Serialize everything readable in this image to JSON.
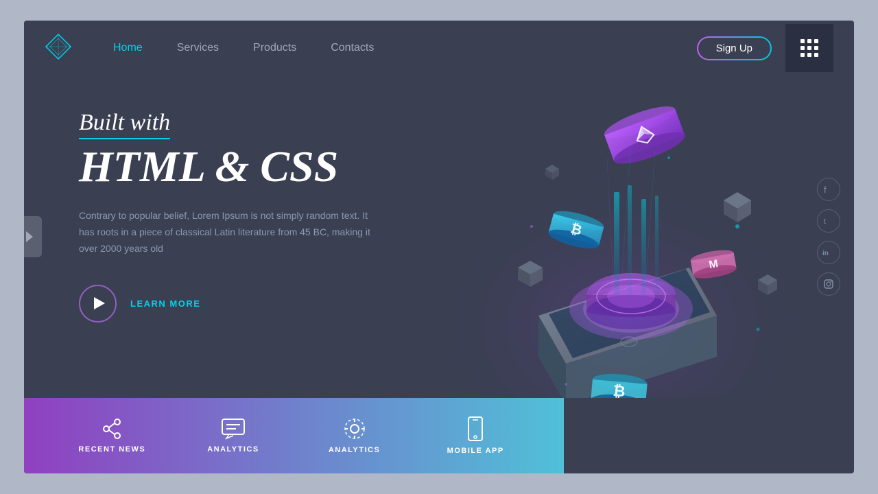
{
  "nav": {
    "links": [
      {
        "label": "Home",
        "active": true
      },
      {
        "label": "Services",
        "active": false
      },
      {
        "label": "Products",
        "active": false
      },
      {
        "label": "Contacts",
        "active": false
      }
    ],
    "signup_label": "Sign Up"
  },
  "hero": {
    "built_with": "Built with",
    "headline": "HTML & CSS",
    "description": "Contrary to popular belief, Lorem Ipsum is not simply random text. It has roots in a piece of classical Latin literature from 45 BC, making it over 2000 years old",
    "cta_label": "LEARN MORE"
  },
  "bottom_bar": {
    "items": [
      {
        "icon": "share-icon",
        "label": "RECENT NEWS"
      },
      {
        "icon": "chat-icon",
        "label": "ANALYTICS"
      },
      {
        "icon": "settings-icon",
        "label": "MOBILE APP"
      }
    ]
  },
  "social": {
    "icons": [
      {
        "name": "facebook-icon",
        "char": "f"
      },
      {
        "name": "twitter-icon",
        "char": "t"
      },
      {
        "name": "linkedin-icon",
        "char": "in"
      },
      {
        "name": "instagram-icon",
        "char": "ig"
      }
    ]
  },
  "colors": {
    "accent_cyan": "#00d4e8",
    "accent_purple": "#9040c0",
    "bg_dark": "#3a3f52",
    "bg_darker": "#2a2f42"
  }
}
